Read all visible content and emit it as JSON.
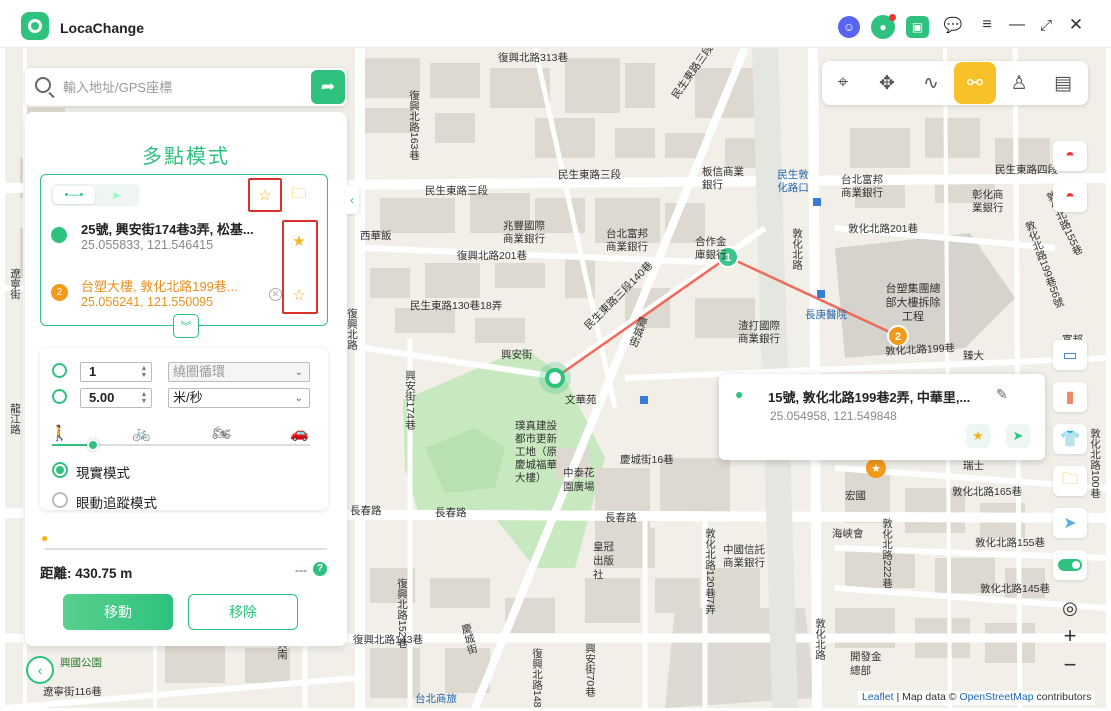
{
  "app": {
    "name": "LocaChange"
  },
  "search": {
    "placeholder": "輸入地址/GPS座標"
  },
  "panel": {
    "title": "多點模式",
    "points": [
      {
        "title": "25號, 興安街174巷3弄, 松基...",
        "coord": "25.055833, 121.546415"
      },
      {
        "index": "2",
        "title": "台塑大樓, 敦化北路199巷...",
        "coord": "25.056241, 121.550095"
      }
    ],
    "loop_count": "1",
    "loop_mode": "繞圈循環",
    "speed_value": "5.00",
    "speed_unit": "米/秒",
    "speed_level": 0.16,
    "modes": [
      "現實模式",
      "眼動追蹤模式"
    ],
    "selected_mode": 0,
    "progress": 0,
    "distance_label": "距離: 430.75 m",
    "eta": "---",
    "move_button": "移動",
    "remove_button": "移除"
  },
  "popup": {
    "title": "15號, 敦化北路199巷2弄, 中華里,...",
    "coord": "25.054958, 121.549848"
  },
  "map": {
    "labels": {
      "l1": "民生東路三段",
      "l2": "民生東路三段",
      "l3": "民生東路四段",
      "l4": "復興北路313巷",
      "l5": "復興北路201巷",
      "l6": "民生東路130巷18弄",
      "l7": "興安街",
      "l8": "慶城街",
      "l9": "民生東路三段140巷",
      "l10": "敦化北路201巷",
      "l11": "敦化北路199巷",
      "l12": "敦化北路165巷",
      "l13": "敦化北路155巷",
      "l14": "敦化北路145巷",
      "l15": "長春路",
      "l16": "長春路",
      "l17": "長春路",
      "l18": "復興北路143巷",
      "l19": "慶城街16巷",
      "l20": "敦化北路",
      "l21": "敦化北路",
      "l22": "復興北路",
      "l23": "台塑集團總部大樓拆除工程",
      "l24": "長庚醫院",
      "l25": "文華苑",
      "l26": "中泰花園廣場",
      "l27": "宏國",
      "l28": "皇冠出版社",
      "l29": "興國公園",
      "l30": "遼寧街116巷",
      "l31": "台北商旅",
      "l32": "開發金總部",
      "l33": "海峽會",
      "l34": "西華飯",
      "l35": "兆豐國際商業銀行",
      "l36": "台北富邦商業銀行",
      "l37": "合作金庫銀行",
      "l38": "渣打國際商業銀行",
      "l39": "板信商業銀行",
      "l40": "民生敦化路口",
      "l41": "彰化商業銀行",
      "l42": "台北富邦商業銀行",
      "l43": "中國信託商業銀行",
      "l44": "富邦",
      "l45": "璞真建設都市更新工地（原慶城福華大樓）",
      "l46": "臻大",
      "l47": "瑞士",
      "l48": "慶城街",
      "l49": "復興南",
      "l50": "敦化北路120巷7弄",
      "l51": "敦化北路222巷",
      "l52": "敦化北路199巷56號",
      "l53": "敦化北路100巷",
      "l54": "遼寧街",
      "l55": "龍江路",
      "l56": "復興北路163巷",
      "l57": "興安街174巷",
      "l58": "復興北路152巷",
      "l59": "復興北路148巷",
      "l60": "民生東路三段113巷",
      "l61": "興安街70巷",
      "l62": "敦化北路155巷"
    }
  },
  "attribution": {
    "leaflet": "Leaflet",
    "sep1": " | Map data © ",
    "osm": "OpenStreetMap",
    "tail": " contributors"
  },
  "colors": {
    "accent": "#2ec27e",
    "route": "#ee6a5a",
    "active_point": "#f39a1d",
    "highlight": "#d9322b",
    "selected_tool": "#f8c12a"
  }
}
